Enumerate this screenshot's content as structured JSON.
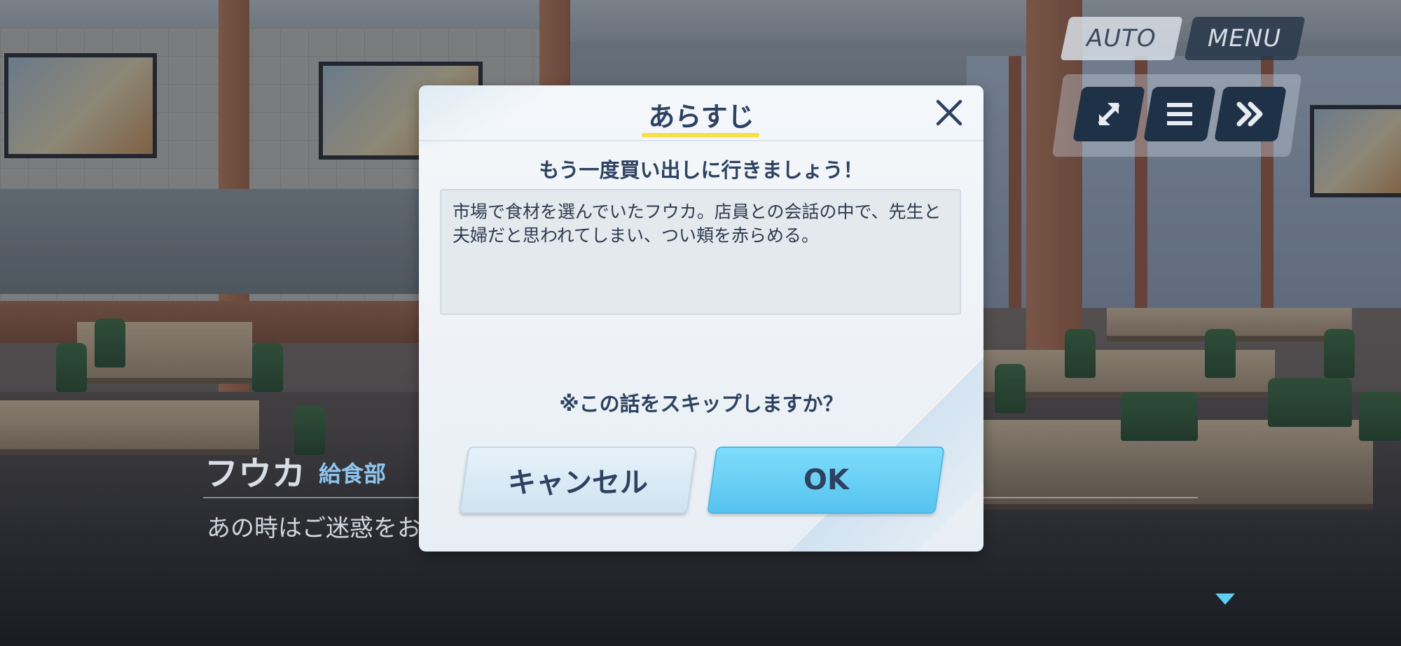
{
  "controls": {
    "auto_label": "AUTO",
    "menu_label": "MENU",
    "icons": [
      "fullscreen-icon",
      "log-icon",
      "fast-forward-icon"
    ]
  },
  "dialogue": {
    "speaker": "フウカ",
    "club": "給食部",
    "text": "あの時はご迷惑をお"
  },
  "modal": {
    "title": "あらすじ",
    "episode_title": "もう一度買い出しに行きましょう！",
    "synopsis": "市場で食材を選んでいたフウカ。店員との会話の中で、先生と夫婦だと思われてしまい、つい頬を赤らめる。",
    "confirm_text": "※この話をスキップしますか？",
    "cancel_label": "キャンセル",
    "ok_label": "OK"
  },
  "colors": {
    "title_text": "#2d4160",
    "underline": "#f4e04a",
    "ok_button": "#56c4ef",
    "cancel_button": "#cfe3f0",
    "club_text": "#8ec5ef"
  }
}
